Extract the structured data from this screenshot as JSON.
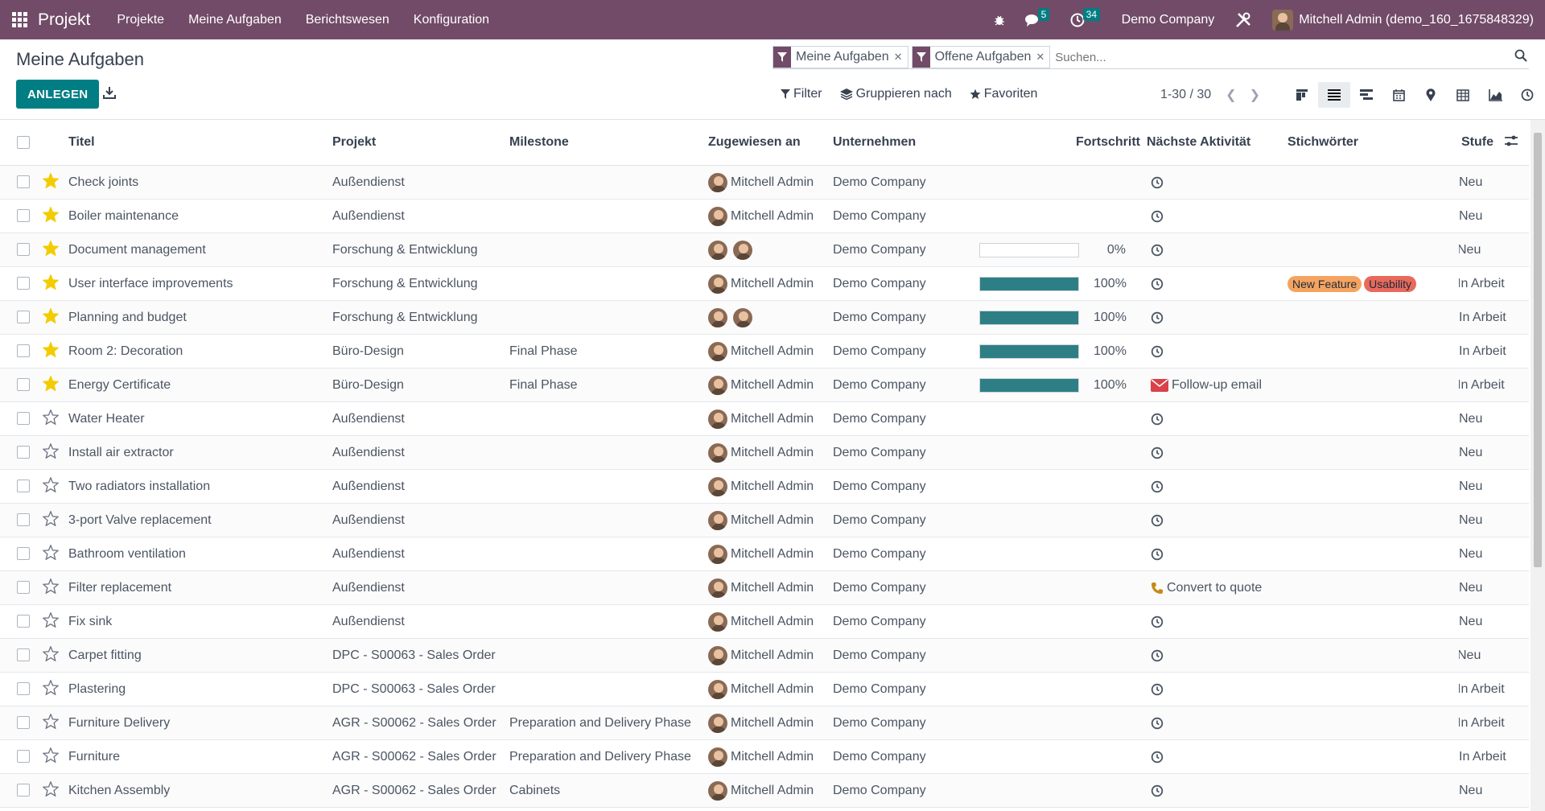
{
  "navbar": {
    "brand": "Projekt",
    "menus": [
      "Projekte",
      "Meine Aufgaben",
      "Berichtswesen",
      "Konfiguration"
    ],
    "messages_badge": "5",
    "activities_badge": "34",
    "company": "Demo Company",
    "user": "Mitchell Admin (demo_160_1675848329)",
    "icons": [
      "apps-icon",
      "bug-icon",
      "chat-icon",
      "clock-icon",
      "tools-icon"
    ],
    "color": "#714B67"
  },
  "control_panel": {
    "title": "Meine Aufgaben",
    "create_label": "ANLEGEN",
    "facets": [
      "Meine Aufgaben",
      "Offene Aufgaben"
    ],
    "search_placeholder": "Suchen...",
    "filter_label": "Filter",
    "group_label": "Gruppieren nach",
    "favorites_label": "Favoriten",
    "pager": "1-30 / 30",
    "views": [
      "kanban",
      "list",
      "gantt",
      "calendar",
      "map",
      "pivot",
      "graph",
      "activity"
    ],
    "active_view": "list"
  },
  "table": {
    "headers": [
      "Titel",
      "Projekt",
      "Milestone",
      "Zugewiesen an",
      "Unternehmen",
      "Fortschritt",
      "Nächste Aktivität",
      "Stichwörter",
      "Stufe"
    ],
    "rows": [
      {
        "starred": true,
        "title": "Check joints",
        "project": "Außendienst",
        "milestone": "",
        "assignee": "Mitchell Admin",
        "avatars": 1,
        "company": "Demo Company",
        "progress": null,
        "activity": {
          "type": "clock",
          "text": ""
        },
        "tags": [],
        "stage": "Neu",
        "status": "grey"
      },
      {
        "starred": true,
        "title": "Boiler maintenance",
        "project": "Außendienst",
        "milestone": "",
        "assignee": "Mitchell Admin",
        "avatars": 1,
        "company": "Demo Company",
        "progress": null,
        "activity": {
          "type": "clock",
          "text": ""
        },
        "tags": [],
        "stage": "Neu",
        "status": "grey"
      },
      {
        "starred": true,
        "title": "Document management",
        "project": "Forschung & Entwicklung",
        "milestone": "",
        "assignee": "",
        "avatars": 2,
        "company": "Demo Company",
        "progress": 0,
        "activity": {
          "type": "clock",
          "text": ""
        },
        "tags": [],
        "stage": "Neu",
        "status": "green"
      },
      {
        "starred": true,
        "title": "User interface improvements",
        "project": "Forschung & Entwicklung",
        "milestone": "",
        "assignee": "Mitchell Admin",
        "avatars": 1,
        "company": "Demo Company",
        "progress": 100,
        "activity": {
          "type": "clock",
          "text": ""
        },
        "tags": [
          {
            "label": "New Feature",
            "color": "#f4a460"
          },
          {
            "label": "Usability",
            "color": "#e86a5c"
          }
        ],
        "stage": "In Arbeit",
        "status": "green"
      },
      {
        "starred": true,
        "title": "Planning and budget",
        "project": "Forschung & Entwicklung",
        "milestone": "",
        "assignee": "",
        "avatars": 2,
        "company": "Demo Company",
        "progress": 100,
        "activity": {
          "type": "clock",
          "text": ""
        },
        "tags": [],
        "stage": "In Arbeit",
        "status": "grey"
      },
      {
        "starred": true,
        "title": "Room 2: Decoration",
        "project": "Büro-Design",
        "milestone": "Final Phase",
        "assignee": "Mitchell Admin",
        "avatars": 1,
        "company": "Demo Company",
        "progress": 100,
        "activity": {
          "type": "clock",
          "text": ""
        },
        "tags": [],
        "stage": "In Arbeit",
        "status": "grey"
      },
      {
        "starred": true,
        "title": "Energy Certificate",
        "project": "Büro-Design",
        "milestone": "Final Phase",
        "assignee": "Mitchell Admin",
        "avatars": 1,
        "company": "Demo Company",
        "progress": 100,
        "activity": {
          "type": "email",
          "text": "Follow-up email"
        },
        "tags": [],
        "stage": "In Arbeit",
        "status": "red"
      },
      {
        "starred": false,
        "title": "Water Heater",
        "project": "Außendienst",
        "milestone": "",
        "assignee": "Mitchell Admin",
        "avatars": 1,
        "company": "Demo Company",
        "progress": null,
        "activity": {
          "type": "clock",
          "text": ""
        },
        "tags": [],
        "stage": "Neu",
        "status": "grey"
      },
      {
        "starred": false,
        "title": "Install air extractor",
        "project": "Außendienst",
        "milestone": "",
        "assignee": "Mitchell Admin",
        "avatars": 1,
        "company": "Demo Company",
        "progress": null,
        "activity": {
          "type": "clock",
          "text": ""
        },
        "tags": [],
        "stage": "Neu",
        "status": "grey"
      },
      {
        "starred": false,
        "title": "Two radiators installation",
        "project": "Außendienst",
        "milestone": "",
        "assignee": "Mitchell Admin",
        "avatars": 1,
        "company": "Demo Company",
        "progress": null,
        "activity": {
          "type": "clock",
          "text": ""
        },
        "tags": [],
        "stage": "Neu",
        "status": "grey"
      },
      {
        "starred": false,
        "title": "3-port Valve replacement",
        "project": "Außendienst",
        "milestone": "",
        "assignee": "Mitchell Admin",
        "avatars": 1,
        "company": "Demo Company",
        "progress": null,
        "activity": {
          "type": "clock",
          "text": ""
        },
        "tags": [],
        "stage": "Neu",
        "status": "grey"
      },
      {
        "starred": false,
        "title": "Bathroom ventilation",
        "project": "Außendienst",
        "milestone": "",
        "assignee": "Mitchell Admin",
        "avatars": 1,
        "company": "Demo Company",
        "progress": null,
        "activity": {
          "type": "clock",
          "text": ""
        },
        "tags": [],
        "stage": "Neu",
        "status": "grey"
      },
      {
        "starred": false,
        "title": "Filter replacement",
        "project": "Außendienst",
        "milestone": "",
        "assignee": "Mitchell Admin",
        "avatars": 1,
        "company": "Demo Company",
        "progress": null,
        "activity": {
          "type": "phone",
          "text": "Convert to quote"
        },
        "tags": [],
        "stage": "Neu",
        "status": "grey"
      },
      {
        "starred": false,
        "title": "Fix sink",
        "project": "Außendienst",
        "milestone": "",
        "assignee": "Mitchell Admin",
        "avatars": 1,
        "company": "Demo Company",
        "progress": null,
        "activity": {
          "type": "clock",
          "text": ""
        },
        "tags": [],
        "stage": "Neu",
        "status": "grey"
      },
      {
        "starred": false,
        "title": "Carpet fitting",
        "project": "DPC - S00063 - Sales Order",
        "milestone": "",
        "assignee": "Mitchell Admin",
        "avatars": 1,
        "company": "Demo Company",
        "progress": null,
        "activity": {
          "type": "clock",
          "text": ""
        },
        "tags": [],
        "stage": "Neu",
        "status": "red"
      },
      {
        "starred": false,
        "title": "Plastering",
        "project": "DPC - S00063 - Sales Order",
        "milestone": "",
        "assignee": "Mitchell Admin",
        "avatars": 1,
        "company": "Demo Company",
        "progress": null,
        "activity": {
          "type": "clock",
          "text": ""
        },
        "tags": [],
        "stage": "In Arbeit",
        "status": "green"
      },
      {
        "starred": false,
        "title": "Furniture Delivery",
        "project": "AGR - S00062 - Sales Order",
        "milestone": "Preparation and Delivery Phase",
        "assignee": "Mitchell Admin",
        "avatars": 1,
        "company": "Demo Company",
        "progress": null,
        "activity": {
          "type": "clock",
          "text": ""
        },
        "tags": [],
        "stage": "In Arbeit",
        "status": "green"
      },
      {
        "starred": false,
        "title": "Furniture",
        "project": "AGR - S00062 - Sales Order",
        "milestone": "Preparation and Delivery Phase",
        "assignee": "Mitchell Admin",
        "avatars": 1,
        "company": "Demo Company",
        "progress": null,
        "activity": {
          "type": "clock",
          "text": ""
        },
        "tags": [],
        "stage": "In Arbeit",
        "status": "grey"
      },
      {
        "starred": false,
        "title": "Kitchen Assembly",
        "project": "AGR - S00062 - Sales Order",
        "milestone": "Cabinets",
        "assignee": "Mitchell Admin",
        "avatars": 1,
        "company": "Demo Company",
        "progress": null,
        "activity": {
          "type": "clock",
          "text": ""
        },
        "tags": [],
        "stage": "Neu",
        "status": "grey"
      }
    ]
  },
  "colors": {
    "primary": "#017E84",
    "star": "#f3cc00",
    "status_green": "#28a745",
    "status_red": "#dc3545",
    "status_grey": "#e5e7eb"
  }
}
